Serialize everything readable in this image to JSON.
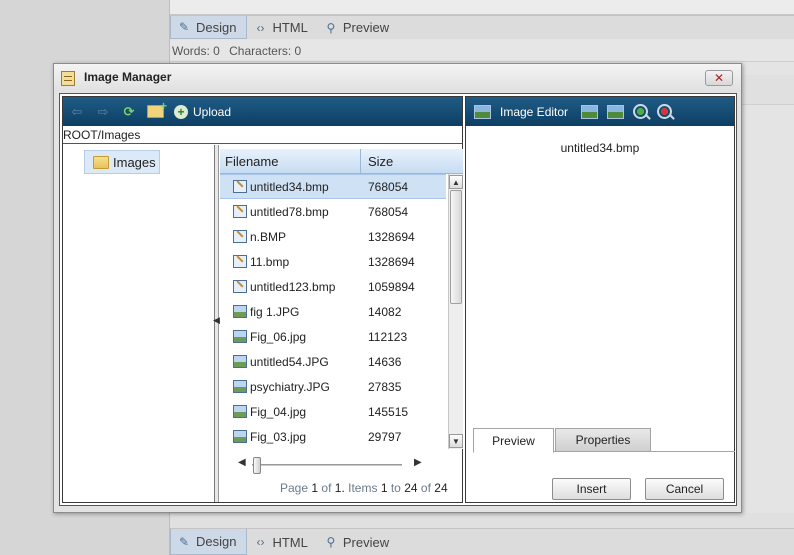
{
  "editor": {
    "tabs": [
      {
        "label": "Design",
        "icon": "pencil-icon"
      },
      {
        "label": "HTML",
        "icon": "code-icon"
      },
      {
        "label": "Preview",
        "icon": "magnifier-icon"
      }
    ],
    "words_label": "Words: 0",
    "characters_label": "Characters: 0"
  },
  "dialog": {
    "title": "Image Manager",
    "close_label": "✕",
    "toolbar": {
      "upload_label": "Upload"
    },
    "path": "ROOT/Images",
    "tree": {
      "items": [
        {
          "label": "Images"
        }
      ]
    },
    "grid": {
      "columns": [
        "Filename",
        "Size"
      ],
      "rows": [
        {
          "name": "untitled34.bmp",
          "size": "768054",
          "type": "bmp",
          "selected": true
        },
        {
          "name": "untitled78.bmp",
          "size": "768054",
          "type": "bmp"
        },
        {
          "name": "n.BMP",
          "size": "1328694",
          "type": "bmp"
        },
        {
          "name": "11.bmp",
          "size": "1328694",
          "type": "bmp"
        },
        {
          "name": "untitled123.bmp",
          "size": "1059894",
          "type": "bmp"
        },
        {
          "name": "fig 1.JPG",
          "size": "14082",
          "type": "jpg"
        },
        {
          "name": "Fig_06.jpg",
          "size": "112123",
          "type": "jpg"
        },
        {
          "name": "untitled54.JPG",
          "size": "14636",
          "type": "jpg"
        },
        {
          "name": "psychiatry.JPG",
          "size": "27835",
          "type": "jpg"
        },
        {
          "name": "Fig_04.jpg",
          "size": "145515",
          "type": "jpg"
        },
        {
          "name": "Fig_03.jpg",
          "size": "29797",
          "type": "jpg"
        }
      ]
    },
    "pager": {
      "page_word": "Page",
      "page": "1",
      "of_word": "of",
      "pages": "1.",
      "items_word": "Items",
      "from": "1",
      "to_word": "to",
      "to": "24",
      "of_word2": "of",
      "total": "24"
    },
    "image_editor": {
      "label": "Image Editor",
      "selected_file": "untitled34.bmp",
      "tabs": [
        "Preview",
        "Properties"
      ],
      "insert_label": "Insert",
      "cancel_label": "Cancel"
    }
  }
}
